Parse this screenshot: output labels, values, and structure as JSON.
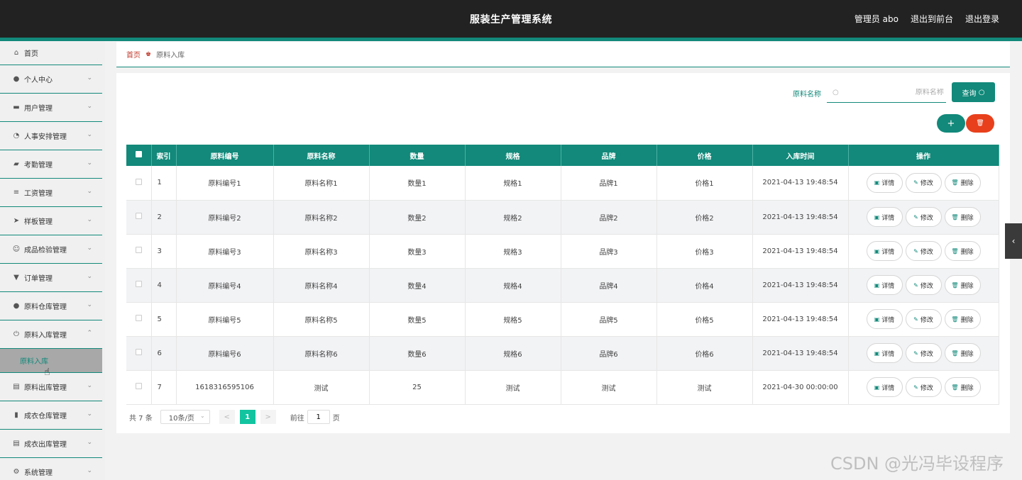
{
  "header": {
    "title": "服装生产管理系统",
    "user": "管理员 abo",
    "to_front": "退出到前台",
    "logout": "退出登录"
  },
  "sidebar": {
    "items": [
      {
        "label": "首页",
        "icon": "home-icon",
        "glyph": "⌂",
        "chevron": ""
      },
      {
        "label": "个人中心",
        "icon": "user-icon",
        "glyph": "●",
        "chevron": "⌄"
      },
      {
        "label": "用户管理",
        "icon": "users-icon",
        "glyph": "▬",
        "chevron": "⌄"
      },
      {
        "label": "人事安排管理",
        "icon": "dashboard-icon",
        "glyph": "◔",
        "chevron": "⌄"
      },
      {
        "label": "考勤管理",
        "icon": "comment-icon",
        "glyph": "▰",
        "chevron": "⌄"
      },
      {
        "label": "工资管理",
        "icon": "list-icon",
        "glyph": "≡",
        "chevron": "⌄"
      },
      {
        "label": "样板管理",
        "icon": "send-icon",
        "glyph": "➤",
        "chevron": "⌄"
      },
      {
        "label": "成品检验管理",
        "icon": "smile-icon",
        "glyph": "☺",
        "chevron": "⌄"
      },
      {
        "label": "订单管理",
        "icon": "order-icon",
        "glyph": "▼",
        "chevron": "⌄"
      },
      {
        "label": "原料仓库管理",
        "icon": "person-icon",
        "glyph": "●",
        "chevron": "⌄"
      },
      {
        "label": "原料入库管理",
        "icon": "power-icon",
        "glyph": "⏻",
        "chevron": "⌃"
      }
    ],
    "sub_active": "原料入库",
    "items_after": [
      {
        "label": "原料出库管理",
        "icon": "clipboard-icon",
        "glyph": "▤",
        "chevron": "⌄"
      },
      {
        "label": "成衣仓库管理",
        "icon": "bar-chart-icon",
        "glyph": "▮",
        "chevron": "⌄"
      },
      {
        "label": "成衣出库管理",
        "icon": "clipboard-icon",
        "glyph": "▤",
        "chevron": "⌄"
      },
      {
        "label": "系统管理",
        "icon": "settings-icon",
        "glyph": "⚙",
        "chevron": "⌄"
      }
    ]
  },
  "breadcrumb": {
    "home": "首页",
    "current": "原料入库"
  },
  "search": {
    "label": "原料名称",
    "placeholder": "原料名称",
    "button": "查询"
  },
  "toolbar": {
    "add": "+",
    "delete": "🗑"
  },
  "table": {
    "columns": [
      "索引",
      "原料编号",
      "原料名称",
      "数量",
      "规格",
      "品牌",
      "价格",
      "入库时间",
      "操作"
    ],
    "rows": [
      [
        "1",
        "原料编号1",
        "原料名称1",
        "数量1",
        "规格1",
        "品牌1",
        "价格1",
        "2021-04-13 19:48:54"
      ],
      [
        "2",
        "原料编号2",
        "原料名称2",
        "数量2",
        "规格2",
        "品牌2",
        "价格2",
        "2021-04-13 19:48:54"
      ],
      [
        "3",
        "原料编号3",
        "原料名称3",
        "数量3",
        "规格3",
        "品牌3",
        "价格3",
        "2021-04-13 19:48:54"
      ],
      [
        "4",
        "原料编号4",
        "原料名称4",
        "数量4",
        "规格4",
        "品牌4",
        "价格4",
        "2021-04-13 19:48:54"
      ],
      [
        "5",
        "原料编号5",
        "原料名称5",
        "数量5",
        "规格5",
        "品牌5",
        "价格5",
        "2021-04-13 19:48:54"
      ],
      [
        "6",
        "原料编号6",
        "原料名称6",
        "数量6",
        "规格6",
        "品牌6",
        "价格6",
        "2021-04-13 19:48:54"
      ],
      [
        "7",
        "1618316595106",
        "测试",
        "25",
        "测试",
        "测试",
        "测试",
        "2021-04-30 00:00:00"
      ]
    ],
    "actions": {
      "detail": "详情",
      "edit": "修改",
      "delete": "删除"
    }
  },
  "pagination": {
    "total": "共 7 条",
    "page_size": "10条/页",
    "prev": "<",
    "current": "1",
    "next": ">",
    "goto_label": "前往",
    "goto_value": "1",
    "page_unit": "页"
  },
  "watermark": "CSDN @光冯毕设程序",
  "colors": {
    "primary": "#12897a",
    "danger": "#e8401c",
    "header": "#222222"
  }
}
